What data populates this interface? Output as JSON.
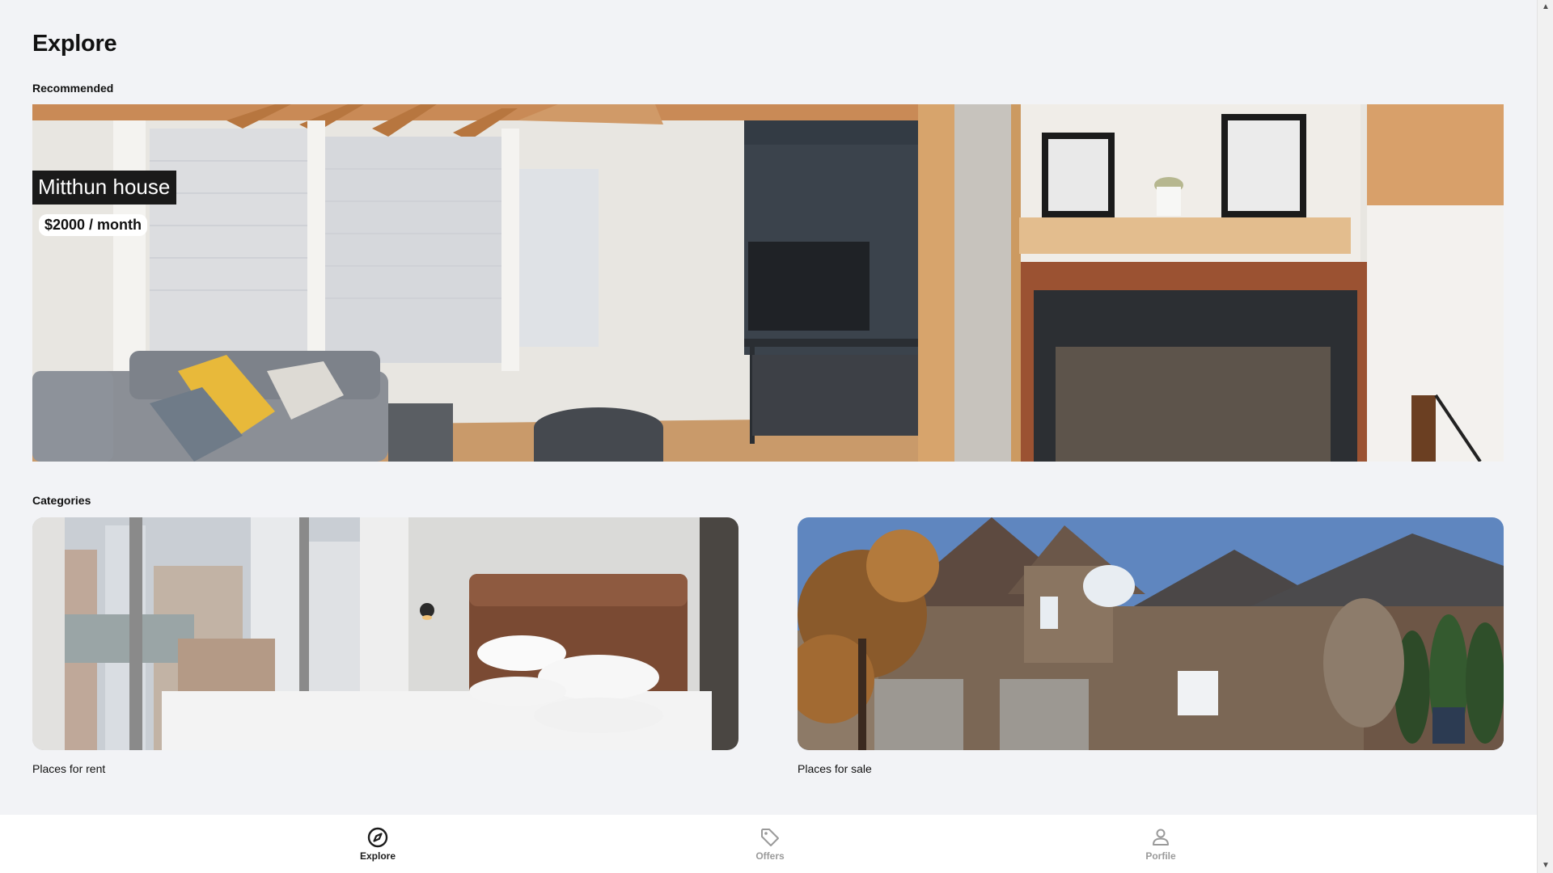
{
  "page": {
    "title": "Explore"
  },
  "recommended": {
    "label": "Recommended",
    "name": "Mitthun house",
    "price": "$2000 / month"
  },
  "categories": {
    "label": "Categories",
    "items": [
      {
        "label": "Places for rent"
      },
      {
        "label": "Places for sale"
      }
    ]
  },
  "bottom_nav": {
    "items": [
      {
        "label": "Explore",
        "icon": "compass-icon",
        "active": true
      },
      {
        "label": "Offers",
        "icon": "tag-icon",
        "active": false
      },
      {
        "label": "Porfile",
        "icon": "person-icon",
        "active": false
      }
    ]
  },
  "colors": {
    "background": "#f2f3f6",
    "nav_background": "#ffffff",
    "active_nav": "#1c1c1c",
    "inactive_nav": "#9a9a9a"
  }
}
